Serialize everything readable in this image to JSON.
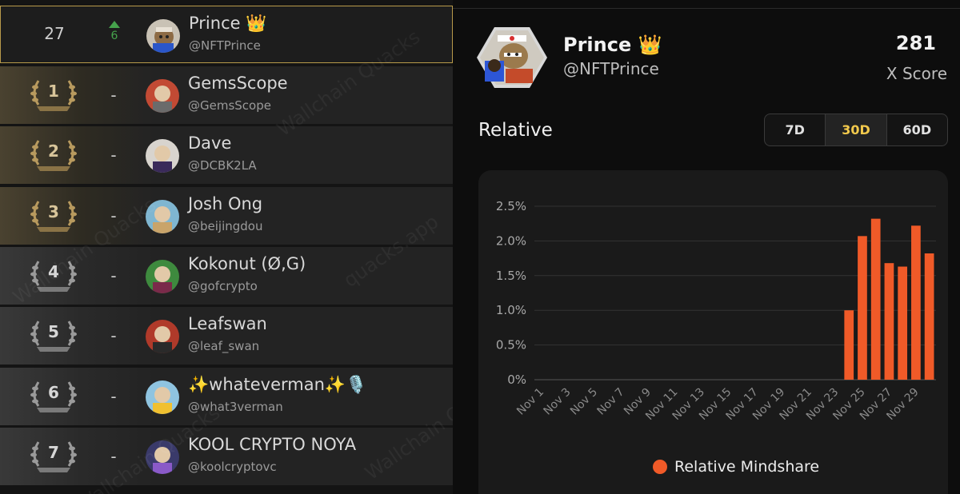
{
  "leaderboard": {
    "current": {
      "rank": "27",
      "change": "6",
      "name": "Prince 👑",
      "handle": "@NFTPrince"
    },
    "rows": [
      {
        "rank": "1",
        "change": "-",
        "name": "GemsScope",
        "handle": "@GemsScope",
        "tier": "gold"
      },
      {
        "rank": "2",
        "change": "-",
        "name": "Dave",
        "handle": "@DCBK2LA",
        "tier": "gold"
      },
      {
        "rank": "3",
        "change": "-",
        "name": "Josh Ong",
        "handle": "@beijingdou",
        "tier": "gold"
      },
      {
        "rank": "4",
        "change": "-",
        "name": "Kokonut (Ø,G)",
        "handle": "@gofcrypto",
        "tier": "silver"
      },
      {
        "rank": "5",
        "change": "-",
        "name": "Leafswan",
        "handle": "@leaf_swan",
        "tier": "silver"
      },
      {
        "rank": "6",
        "change": "-",
        "name": "✨whateverman✨🎙️",
        "handle": "@what3verman",
        "tier": "silver"
      },
      {
        "rank": "7",
        "change": "-",
        "name": "KOOL CRYPTO NOYA",
        "handle": "@koolcryptovc",
        "tier": "silver"
      }
    ],
    "watermark": "Wallchain Quacks",
    "watermark2": "quacks.app"
  },
  "profile": {
    "name": "Prince 👑",
    "handle": "@NFTPrince",
    "score": "281",
    "score_label": "X Score"
  },
  "section": {
    "title": "Relative",
    "ranges": [
      "7D",
      "30D",
      "60D"
    ],
    "active_range": "30D"
  },
  "colors": {
    "accent": "#f2c94c",
    "bar": "#f05a28",
    "up": "#46a24c",
    "current_border": "#b89a4a"
  },
  "chart_data": {
    "type": "bar",
    "title": "",
    "xlabel": "",
    "ylabel": "",
    "y_tick_labels": [
      "0%",
      "0.5%",
      "1.0%",
      "1.5%",
      "2.0%",
      "2.5%"
    ],
    "ylim": [
      0,
      2.5
    ],
    "x_tick_labels": [
      "Nov 1",
      "Nov 3",
      "Nov 5",
      "Nov 7",
      "Nov 9",
      "Nov 11",
      "Nov 13",
      "Nov 15",
      "Nov 17",
      "Nov 19",
      "Nov 21",
      "Nov 23",
      "Nov 25",
      "Nov 27",
      "Nov 29"
    ],
    "categories": [
      "Nov 1",
      "Nov 2",
      "Nov 3",
      "Nov 4",
      "Nov 5",
      "Nov 6",
      "Nov 7",
      "Nov 8",
      "Nov 9",
      "Nov 10",
      "Nov 11",
      "Nov 12",
      "Nov 13",
      "Nov 14",
      "Nov 15",
      "Nov 16",
      "Nov 17",
      "Nov 18",
      "Nov 19",
      "Nov 20",
      "Nov 21",
      "Nov 22",
      "Nov 23",
      "Nov 24",
      "Nov 25",
      "Nov 26",
      "Nov 27",
      "Nov 28",
      "Nov 29",
      "Nov 30"
    ],
    "series": [
      {
        "name": "Relative Mindshare",
        "values": [
          0,
          0,
          0,
          0,
          0,
          0,
          0,
          0,
          0,
          0,
          0,
          0,
          0,
          0,
          0,
          0,
          0,
          0,
          0,
          0,
          0,
          0,
          0,
          1.0,
          2.07,
          2.32,
          1.68,
          1.63,
          2.22,
          1.82
        ]
      }
    ],
    "grid": true,
    "legend": "bottom"
  }
}
